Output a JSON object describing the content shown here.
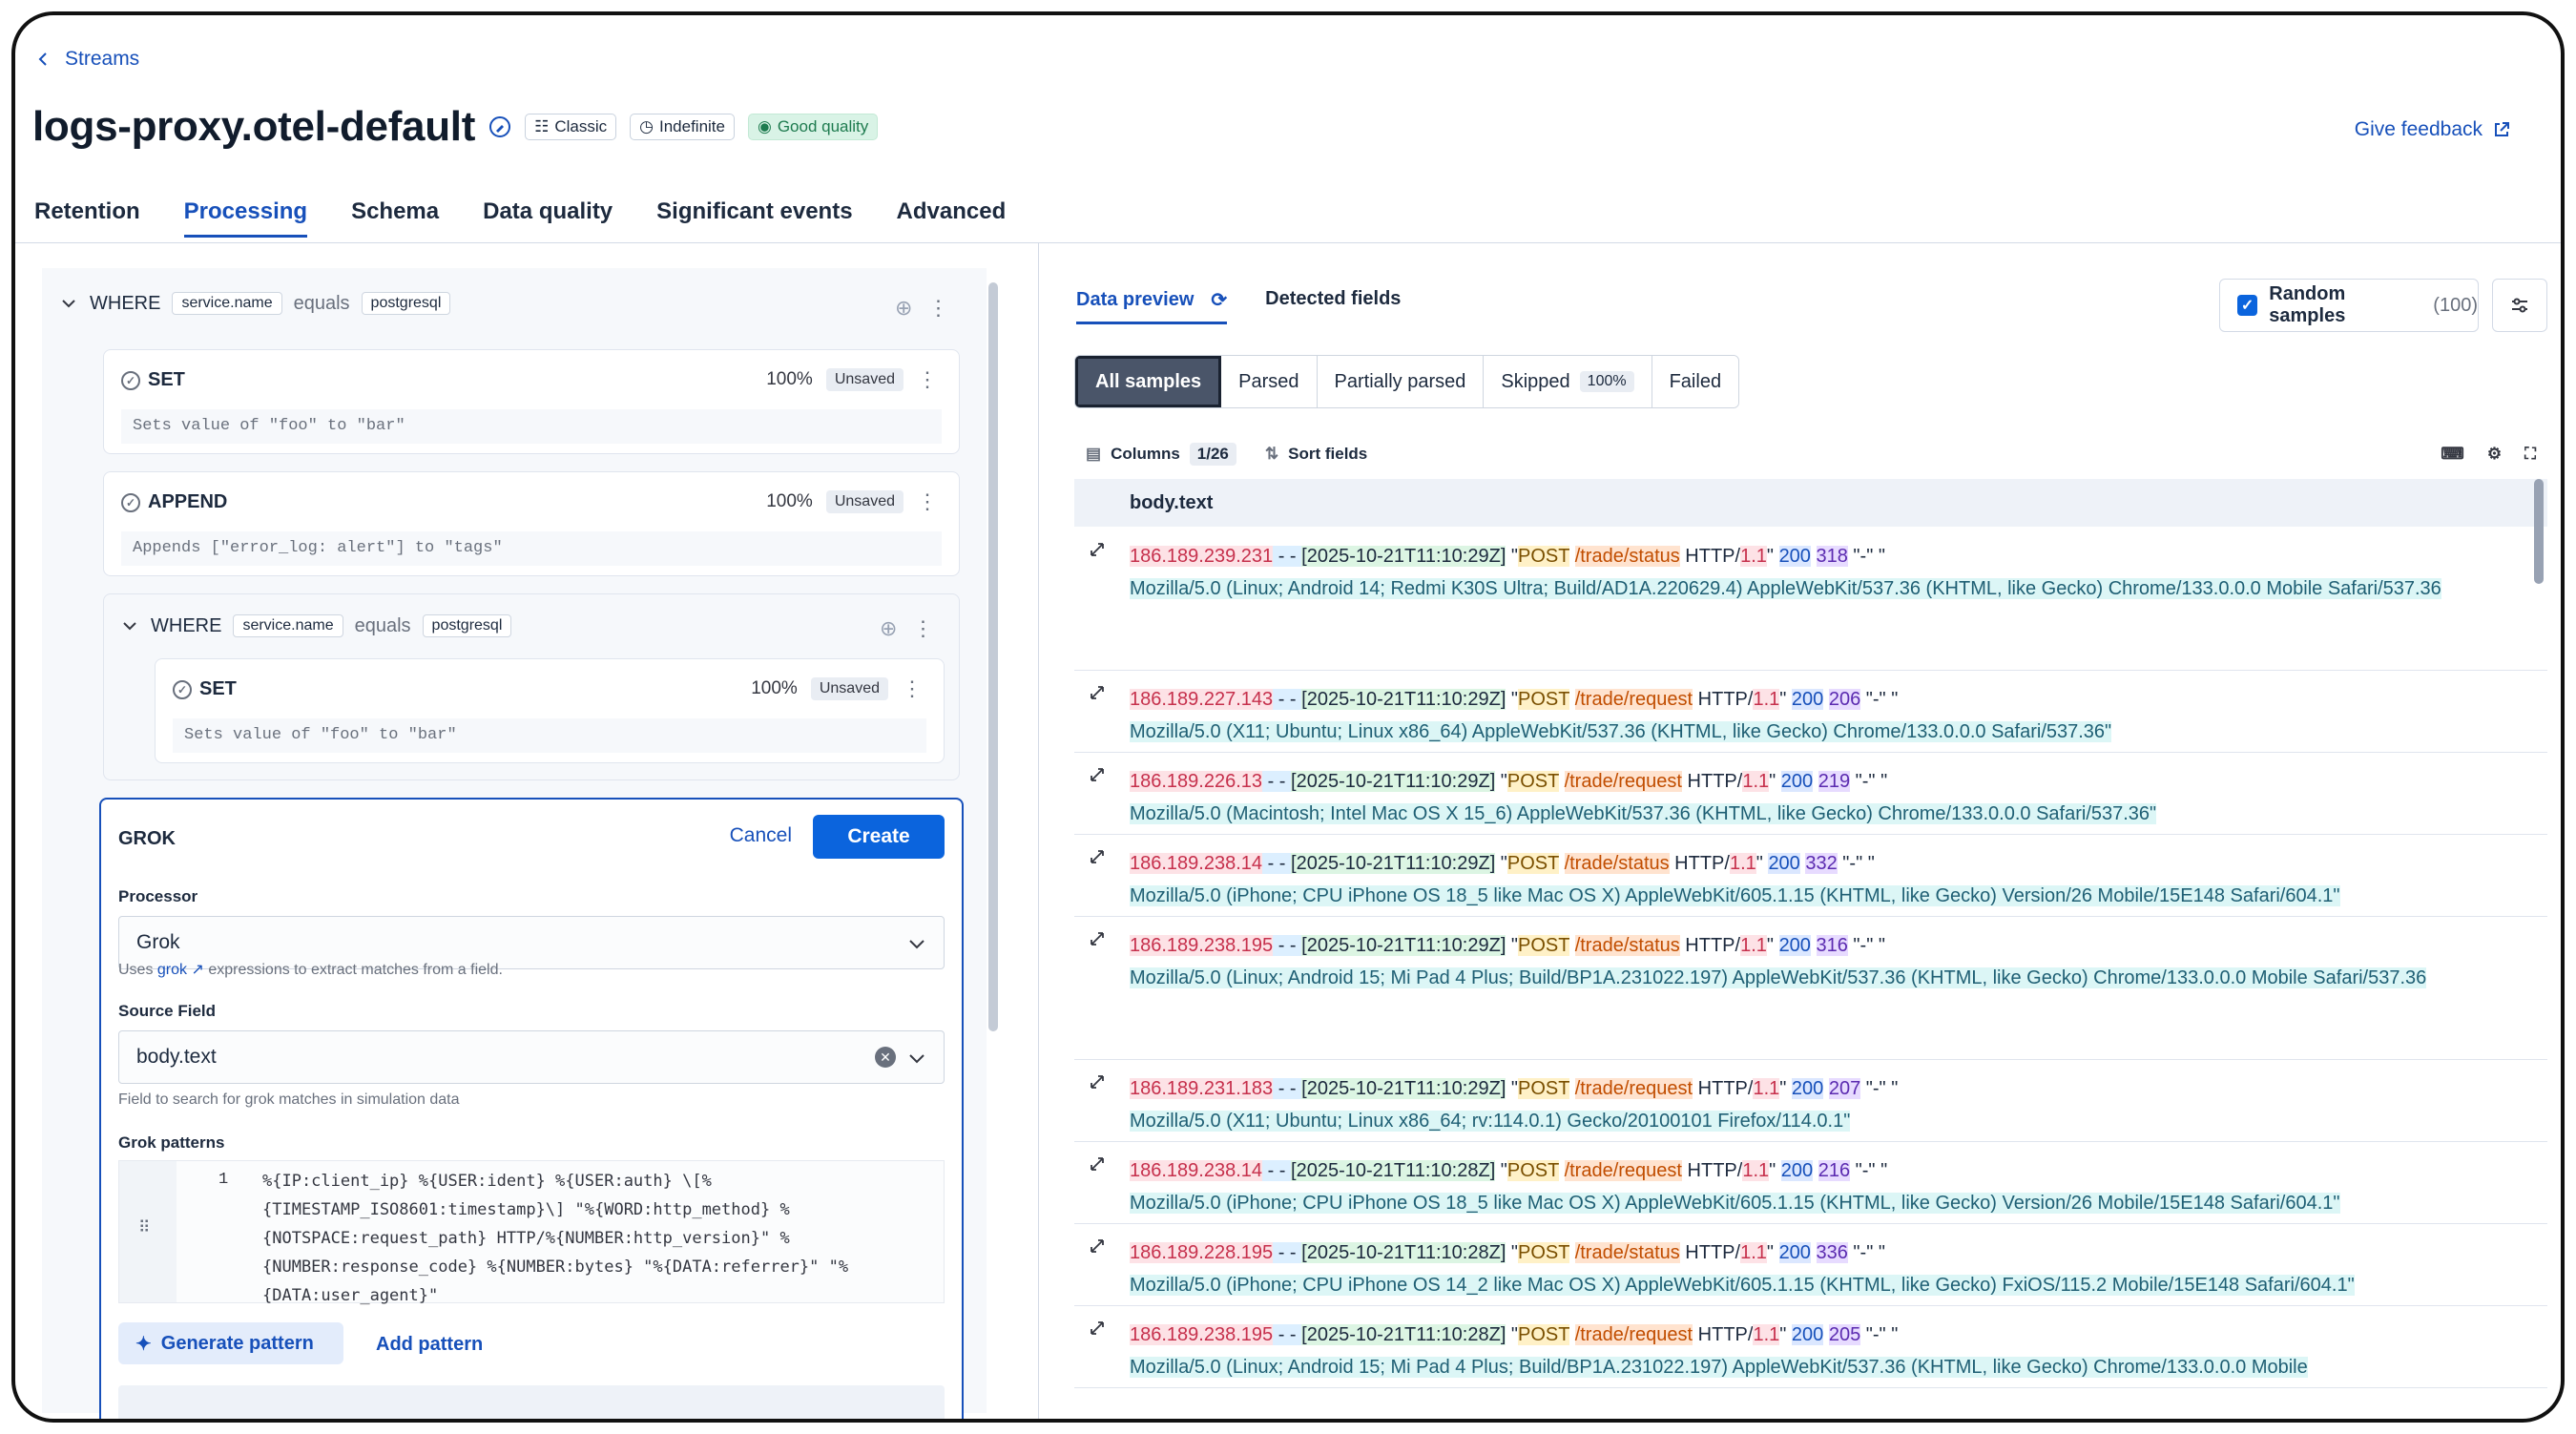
{
  "breadcrumb": {
    "label": "Streams"
  },
  "header": {
    "title": "logs-proxy.otel-default",
    "badges": [
      "Classic",
      "Indefinite",
      "Good quality"
    ],
    "feedback": "Give feedback"
  },
  "tabs": [
    "Retention",
    "Processing",
    "Schema",
    "Data quality",
    "Significant events",
    "Advanced"
  ],
  "processing": {
    "where1": {
      "keyword": "WHERE",
      "field": "service.name",
      "op": "equals",
      "value": "postgresql"
    },
    "set1": {
      "name": "SET",
      "pct": "100%",
      "status": "Unsaved",
      "desc": "Sets value of \"foo\" to \"bar\""
    },
    "append": {
      "name": "APPEND",
      "pct": "100%",
      "status": "Unsaved",
      "desc": "Appends [\"error_log: alert\"] to \"tags\""
    },
    "where2": {
      "keyword": "WHERE",
      "field": "service.name",
      "op": "equals",
      "value": "postgresql"
    },
    "set2": {
      "name": "SET",
      "pct": "100%",
      "status": "Unsaved",
      "desc": "Sets value of \"foo\" to \"bar\""
    },
    "grok": {
      "title": "GROK",
      "cancel": "Cancel",
      "create": "Create",
      "processor_label": "Processor",
      "processor_value": "Grok",
      "processor_help_pre": "Uses",
      "processor_help_link": "grok",
      "processor_help_post": "expressions to extract matches from a field.",
      "source_label": "Source Field",
      "source_value": "body.text",
      "source_help": "Field to search for grok matches in simulation data",
      "patterns_label": "Grok patterns",
      "line_no": "1",
      "pattern": "%{IP:client_ip} %{USER:ident} %{USER:auth} \\[%\n{TIMESTAMP_ISO8601:timestamp}\\] \"%{WORD:http_method} %\n{NOTSPACE:request_path} HTTP/%{NUMBER:http_version}\" %\n{NUMBER:response_code} %{NUMBER:bytes} \"%{DATA:referrer}\" \"%\n{DATA:user_agent}\"",
      "generate": "Generate pattern",
      "add": "Add pattern"
    }
  },
  "preview": {
    "tab_preview": "Data preview",
    "tab_detected": "Detected fields",
    "random_samples": "Random samples",
    "random_count": "(100)",
    "segments": [
      {
        "label": "All samples",
        "count": ""
      },
      {
        "label": "Parsed",
        "count": ""
      },
      {
        "label": "Partially parsed",
        "count": ""
      },
      {
        "label": "Skipped",
        "count": "100%"
      },
      {
        "label": "Failed",
        "count": ""
      }
    ],
    "columns_label": "Columns",
    "columns_count": "1/26",
    "sort_label": "Sort fields",
    "column_header": "body.text",
    "rows": [
      {
        "ip": "186.189.239.231",
        "ts": "[2025-10-21T11:10:29Z]",
        "method": "POST",
        "path": "/trade/status",
        "hv": "1.1",
        "status": "200",
        "bytes": "318",
        "ua": "Mozilla/5.0 (Linux; Android 14; Redmi K30S Ultra; Build/AD1A.220629.4) AppleWebKit/537.36 (KHTML, like Gecko) Chrome/133.0.0.0 Mobile Safari/537.36"
      },
      {
        "ip": "186.189.227.143",
        "ts": "[2025-10-21T11:10:29Z]",
        "method": "POST",
        "path": "/trade/request",
        "hv": "1.1",
        "status": "200",
        "bytes": "206",
        "ua": "Mozilla/5.0 (X11; Ubuntu; Linux x86_64) AppleWebKit/537.36 (KHTML, like Gecko) Chrome/133.0.0.0 Safari/537.36\""
      },
      {
        "ip": "186.189.226.13",
        "ts": "[2025-10-21T11:10:29Z]",
        "method": "POST",
        "path": "/trade/request",
        "hv": "1.1",
        "status": "200",
        "bytes": "219",
        "ua": "Mozilla/5.0 (Macintosh; Intel Mac OS X 15_6) AppleWebKit/537.36 (KHTML, like Gecko) Chrome/133.0.0.0 Safari/537.36\""
      },
      {
        "ip": "186.189.238.14",
        "ts": "[2025-10-21T11:10:29Z]",
        "method": "POST",
        "path": "/trade/status",
        "hv": "1.1",
        "status": "200",
        "bytes": "332",
        "ua": "Mozilla/5.0 (iPhone; CPU iPhone OS 18_5 like Mac OS X) AppleWebKit/605.1.15 (KHTML, like Gecko) Version/26 Mobile/15E148 Safari/604.1\""
      },
      {
        "ip": "186.189.238.195",
        "ts": "[2025-10-21T11:10:29Z]",
        "method": "POST",
        "path": "/trade/status",
        "hv": "1.1",
        "status": "200",
        "bytes": "316",
        "ua": "Mozilla/5.0 (Linux; Android 15; Mi Pad 4 Plus; Build/BP1A.231022.197) AppleWebKit/537.36 (KHTML, like Gecko) Chrome/133.0.0.0 Mobile Safari/537.36"
      },
      {
        "ip": "186.189.231.183",
        "ts": "[2025-10-21T11:10:29Z]",
        "method": "POST",
        "path": "/trade/request",
        "hv": "1.1",
        "status": "200",
        "bytes": "207",
        "ua": "Mozilla/5.0 (X11; Ubuntu; Linux x86_64; rv:114.0.1) Gecko/20100101 Firefox/114.0.1\""
      },
      {
        "ip": "186.189.238.14",
        "ts": "[2025-10-21T11:10:28Z]",
        "method": "POST",
        "path": "/trade/request",
        "hv": "1.1",
        "status": "200",
        "bytes": "216",
        "ua": "Mozilla/5.0 (iPhone; CPU iPhone OS 18_5 like Mac OS X) AppleWebKit/605.1.15 (KHTML, like Gecko) Version/26 Mobile/15E148 Safari/604.1\""
      },
      {
        "ip": "186.189.228.195",
        "ts": "[2025-10-21T11:10:28Z]",
        "method": "POST",
        "path": "/trade/status",
        "hv": "1.1",
        "status": "200",
        "bytes": "336",
        "ua": "Mozilla/5.0 (iPhone; CPU iPhone OS 14_2 like Mac OS X) AppleWebKit/605.1.15 (KHTML, like Gecko) FxiOS/115.2 Mobile/15E148 Safari/604.1\""
      },
      {
        "ip": "186.189.238.195",
        "ts": "[2025-10-21T11:10:28Z]",
        "method": "POST",
        "path": "/trade/request",
        "hv": "1.1",
        "status": "200",
        "bytes": "205",
        "ua": "Mozilla/5.0 (Linux; Android 15; Mi Pad 4 Plus; Build/BP1A.231022.197) AppleWebKit/537.36 (KHTML, like Gecko) Chrome/133.0.0.0 Mobile"
      }
    ]
  }
}
